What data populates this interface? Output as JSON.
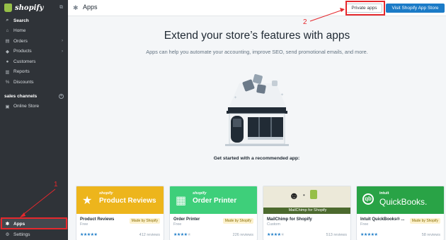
{
  "brand": {
    "logo_text": "shopify"
  },
  "sidebar": {
    "items": [
      {
        "label": "Search",
        "icon": "search-icon"
      },
      {
        "label": "Home",
        "icon": "home-icon"
      },
      {
        "label": "Orders",
        "icon": "orders-icon"
      },
      {
        "label": "Products",
        "icon": "tag-icon"
      },
      {
        "label": "Customers",
        "icon": "customers-icon"
      },
      {
        "label": "Reports",
        "icon": "reports-icon"
      },
      {
        "label": "Discounts",
        "icon": "discounts-icon"
      }
    ],
    "sales_channels_label": "sales channels",
    "online_store_label": "Online Store",
    "apps_label": "Apps",
    "settings_label": "Settings"
  },
  "header": {
    "title": "Apps",
    "private_apps_label": "Private apps",
    "visit_store_label": "Visit Shopify App Store"
  },
  "main": {
    "headline": "Extend your store’s features with apps",
    "subline": "Apps can help you automate your accounting, improve SEO, send promotional emails, and more.",
    "get_started": "Get started with a recommended app:"
  },
  "cards": [
    {
      "brand": "shopify",
      "banner": "Product Reviews",
      "name": "Product Reviews",
      "price": "Free",
      "madeby": "Made by Shopify",
      "reviews": "412 reviews",
      "color": "#edb51c",
      "rating": 5
    },
    {
      "brand": "shopify",
      "banner": "Order Printer",
      "name": "Order Printer",
      "price": "Free",
      "madeby": "Made by Shopify",
      "reviews": "226 reviews",
      "color": "#3ecf7a",
      "rating": 4
    },
    {
      "brand": "",
      "banner": "MailChimp for Shopify",
      "name": "MailChimp for Shopify",
      "price": "Custom",
      "madeby": "",
      "reviews": "513 reviews",
      "color": "#ece9d9",
      "rating": 4
    },
    {
      "brand": "intuit",
      "banner": "QuickBooks.",
      "name": "Intuit QuickBooks® ...",
      "price": "Free",
      "madeby": "Made by Shopify",
      "reviews": "58 reviews",
      "color": "#29a346",
      "rating": 5
    }
  ],
  "annotations": {
    "one": "1",
    "two": "2"
  },
  "colors": {
    "sidebar": "#2f3338",
    "accent": "#1b7bc7",
    "highlight": "#e5282d"
  }
}
